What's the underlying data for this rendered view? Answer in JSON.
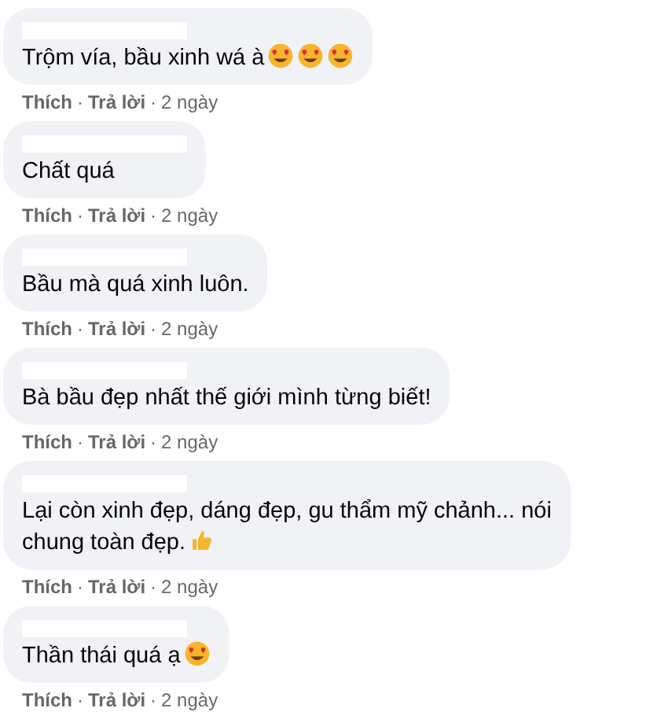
{
  "comments": [
    {
      "lines": [
        "Trộm vía, bầu xinh wá à"
      ],
      "emojis": [
        {
          "kind": "heart-eyes"
        },
        {
          "kind": "heart-eyes"
        },
        {
          "kind": "heart-eyes"
        }
      ],
      "like": "Thích",
      "sep1": "·",
      "reply": "Trả lời",
      "sep2": "·",
      "time": "2 ngày"
    },
    {
      "lines": [
        "Chất quá"
      ],
      "like": "Thích",
      "sep1": "·",
      "reply": "Trả lời",
      "sep2": "·",
      "time": "2 ngày"
    },
    {
      "lines": [
        "Bầu mà quá xinh luôn."
      ],
      "like": "Thích",
      "sep1": "·",
      "reply": "Trả lời",
      "sep2": "·",
      "time": "2 ngày"
    },
    {
      "lines": [
        "Bà bầu đẹp nhất thế giới mình từng biết!"
      ],
      "like": "Thích",
      "sep1": "·",
      "reply": "Trả lời",
      "sep2": "·",
      "time": "2 ngày"
    },
    {
      "lines": [
        "Lại còn xinh đẹp, dáng đẹp, gu thẩm mỹ chảnh... nói",
        "chung toàn đẹp."
      ],
      "emojis": [
        {
          "kind": "thumbs-up"
        }
      ],
      "like": "Thích",
      "sep1": "·",
      "reply": "Trả lời",
      "sep2": "·",
      "time": "2 ngày"
    },
    {
      "lines": [
        "Thần thái quá ạ"
      ],
      "emojis": [
        {
          "kind": "heart-eyes"
        }
      ],
      "like": "Thích",
      "sep1": "·",
      "reply": "Trả lời",
      "sep2": "·",
      "time": "2 ngày"
    }
  ]
}
